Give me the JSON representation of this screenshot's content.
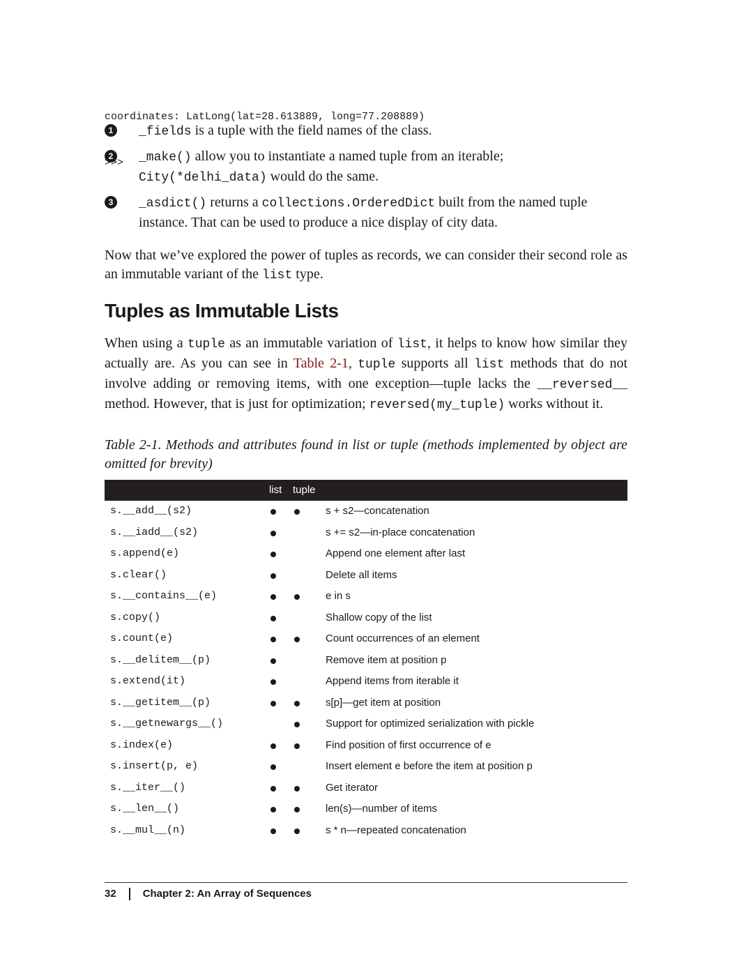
{
  "code_lines": [
    "coordinates: LatLong(lat=28.613889, long=77.208889)",
    ">>>"
  ],
  "callouts": [
    {
      "num": "1",
      "code": "_fields",
      "text": " is a tuple with the field names of the class."
    },
    {
      "num": "2",
      "code": "_make()",
      "text": " allow you to instantiate a named tuple from an iterable; ",
      "code2": "City(*delhi_data)",
      "text2": " would do the same."
    },
    {
      "num": "3",
      "code": "_asdict()",
      "text": " returns a ",
      "code2": "collections.OrderedDict",
      "text2": " built from the named tuple instance. That can be used to produce a nice display of city data."
    }
  ],
  "para1": {
    "t1": "Now that we’ve explored the power of tuples as records, we can consider their second role as an immutable variant of the ",
    "c1": "list",
    "t2": " type."
  },
  "heading": "Tuples as Immutable Lists",
  "para2": {
    "t1": "When using a ",
    "c1": "tuple",
    "t2": " as an immutable variation of ",
    "c2": "list",
    "t3": ", it helps to know how similar they actually are. As you can see in ",
    "link": "Table 2-1",
    "t4": ", ",
    "c3": "tuple",
    "t5": " supports all ",
    "c4": "list",
    "t6": " methods that do not involve adding or removing items, with one exception—tuple lacks the ",
    "c5": "__reversed__",
    "t7": " method. However, that is just for optimization; ",
    "c6": "reversed(my_tuple)",
    "t8": " works without it."
  },
  "caption": "Table 2-1. Methods and attributes found in list or tuple (methods implemented by object are omitted for brevity)",
  "table": {
    "header_list": "list",
    "header_tuple": "tuple",
    "rows": [
      {
        "method": "s.__add__(s2)",
        "list": true,
        "tuple": true,
        "desc": "s + s2—concatenation"
      },
      {
        "method": "s.__iadd__(s2)",
        "list": true,
        "tuple": false,
        "desc": "s += s2—in-place concatenation"
      },
      {
        "method": "s.append(e)",
        "list": true,
        "tuple": false,
        "desc": "Append one element after last"
      },
      {
        "method": "s.clear()",
        "list": true,
        "tuple": false,
        "desc": "Delete all items"
      },
      {
        "method": "s.__contains__(e)",
        "list": true,
        "tuple": true,
        "desc": "e in s"
      },
      {
        "method": "s.copy()",
        "list": true,
        "tuple": false,
        "desc": "Shallow copy of the list"
      },
      {
        "method": "s.count(e)",
        "list": true,
        "tuple": true,
        "desc": "Count occurrences of an element"
      },
      {
        "method": "s.__delitem__(p)",
        "list": true,
        "tuple": false,
        "desc": "Remove item at position p"
      },
      {
        "method": "s.extend(it)",
        "list": true,
        "tuple": false,
        "desc": "Append items from iterable it"
      },
      {
        "method": "s.__getitem__(p)",
        "list": true,
        "tuple": true,
        "desc": "s[p]—get item at position"
      },
      {
        "method": "s.__getnewargs__()",
        "list": false,
        "tuple": true,
        "desc": "Support for optimized serialization with pickle"
      },
      {
        "method": "s.index(e)",
        "list": true,
        "tuple": true,
        "desc": "Find position of first occurrence of e"
      },
      {
        "method": "s.insert(p, e)",
        "list": true,
        "tuple": false,
        "desc": "Insert element e before the item at position p"
      },
      {
        "method": "s.__iter__()",
        "list": true,
        "tuple": true,
        "desc": "Get iterator"
      },
      {
        "method": "s.__len__()",
        "list": true,
        "tuple": true,
        "desc": "len(s)—number of items"
      },
      {
        "method": "s.__mul__(n)",
        "list": true,
        "tuple": true,
        "desc": "s * n—repeated concatenation"
      }
    ]
  },
  "footer": {
    "page_number": "32",
    "chapter": "Chapter 2: An Array of Sequences"
  }
}
